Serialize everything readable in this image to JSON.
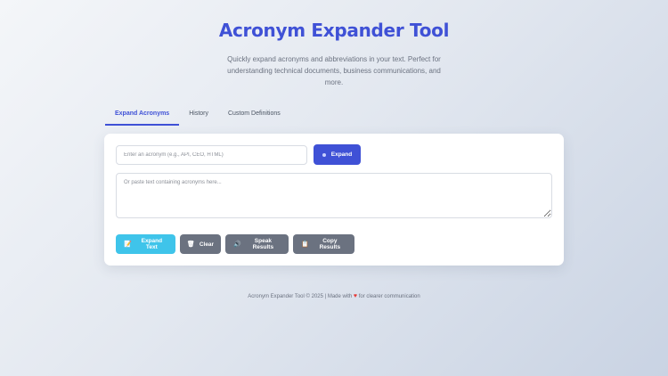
{
  "header": {
    "title": "Acronym Expander Tool",
    "subtitle": "Quickly expand acronyms and abbreviations in your text. Perfect for understanding technical documents, business communications, and more."
  },
  "tabs": [
    {
      "label": "Expand Acronyms",
      "active": true
    },
    {
      "label": "History",
      "active": false
    },
    {
      "label": "Custom Definitions",
      "active": false
    }
  ],
  "form": {
    "acronym_input": {
      "value": "",
      "placeholder": "Enter an acronym (e.g., API, CEO, HTML)"
    },
    "expand_button": {
      "label": "Expand",
      "icon": "sparkle-icon"
    },
    "text_area": {
      "value": "",
      "placeholder": "Or paste text containing acronyms here..."
    }
  },
  "actions": [
    {
      "label": "Expand Text",
      "icon": "note-icon",
      "color": "#3fc4ea"
    },
    {
      "label": "Clear",
      "icon": "trash-icon",
      "color": "#6b7280"
    },
    {
      "label": "Speak Results",
      "icon": "speaker-icon",
      "color": "#6b7280"
    },
    {
      "label": "Copy Results",
      "icon": "clipboard-icon",
      "color": "#6b7280"
    }
  ],
  "footer": {
    "prefix": "Acronym Expander Tool © 2025 | Made with",
    "suffix": "for clearer communication"
  },
  "colors": {
    "accent": "#3f51d6",
    "cyan": "#3fc4ea",
    "gray": "#6b7280",
    "heart": "#e53935"
  }
}
